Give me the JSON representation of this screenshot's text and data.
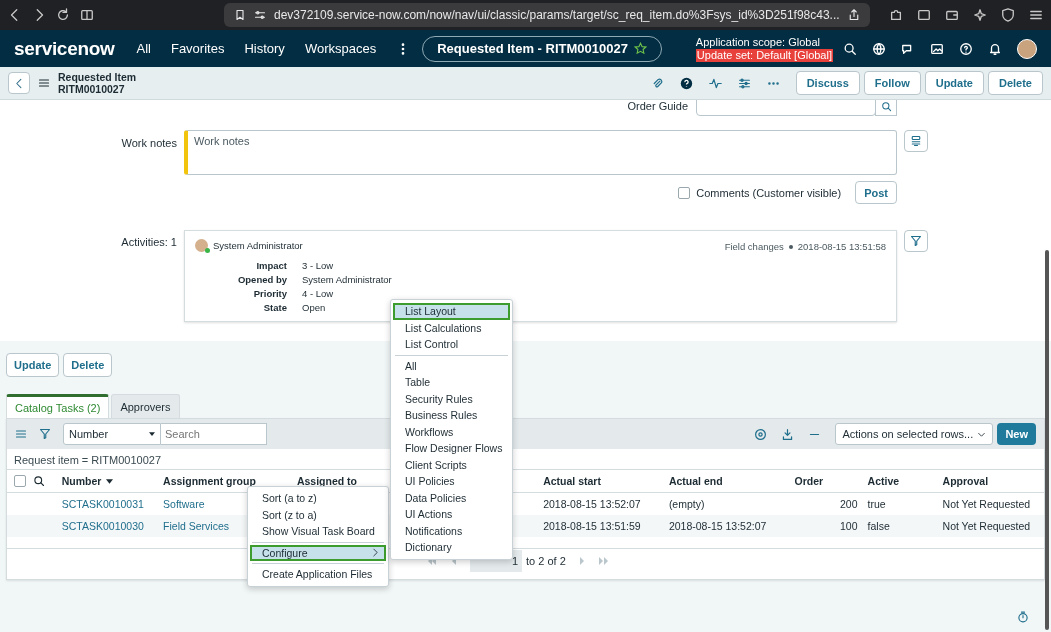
{
  "browser": {
    "url": "dev372109.service-now.com/now/nav/ui/classic/params/target/sc_req_item.do%3Fsys_id%3D251f98c43..."
  },
  "nav": {
    "logo": "servicenow",
    "items": [
      "All",
      "Favorites",
      "History",
      "Workspaces"
    ],
    "title": "Requested Item - RITM0010027",
    "scope": "Application scope: Global",
    "update_set": "Update set: Default [Global]"
  },
  "header": {
    "title": "Requested Item",
    "number": "RITM0010027",
    "buttons": [
      "Discuss",
      "Follow",
      "Update",
      "Delete"
    ]
  },
  "form": {
    "order_guide": "Order Guide",
    "work_notes_label": "Work notes",
    "work_notes_placeholder": "Work notes",
    "comments": {
      "label": "Comments (Customer visible)",
      "checked": false
    },
    "post": "Post",
    "activities_label": "Activities: 1",
    "activity": {
      "user": "System Administrator",
      "meta": "Field changes",
      "time": "2018-08-15 13:51:58",
      "fields": [
        {
          "label": "Impact",
          "value": "3 - Low"
        },
        {
          "label": "Opened by",
          "value": "System Administrator"
        },
        {
          "label": "Priority",
          "value": "4 - Low"
        },
        {
          "label": "State",
          "value": "Open"
        }
      ]
    }
  },
  "bottom_buttons": [
    "Update",
    "Delete"
  ],
  "tabs": [
    {
      "label": "Catalog Tasks (2)",
      "selected": true
    },
    {
      "label": "Approvers",
      "selected": false
    }
  ],
  "list": {
    "select_all_checked": false,
    "filter_field": "Number",
    "search_placeholder": "Search",
    "actions": "Actions on selected rows...",
    "new": "New",
    "breadcrumb": "Request item = RITM0010027",
    "columns": [
      "Number",
      "Assignment group",
      "Assigned to",
      "Actual start",
      "Actual end",
      "Order",
      "Active",
      "Approval"
    ],
    "rows": [
      {
        "number": "SCTASK0010031",
        "group": "Software",
        "start": "2018-08-15 13:52:07",
        "end": "(empty)",
        "order": "200",
        "active": "true",
        "approval": "Not Yet Requested"
      },
      {
        "number": "SCTASK0010030",
        "group": "Field Services",
        "start": "2018-08-15 13:51:59",
        "end": "2018-08-15 13:52:07",
        "order": "100",
        "active": "false",
        "approval": "Not Yet Requested"
      }
    ],
    "page_current": "1",
    "page_range": "to 2 of 2"
  },
  "context_menu": [
    {
      "kind": "item",
      "label": "Sort (a to z)",
      "selected": false
    },
    {
      "kind": "item",
      "label": "Sort (z to a)",
      "selected": false
    },
    {
      "kind": "item",
      "label": "Show Visual Task Board",
      "selected": false
    },
    {
      "kind": "separator"
    },
    {
      "kind": "submenu",
      "label": "Configure",
      "selected": true
    },
    {
      "kind": "separator"
    },
    {
      "kind": "item",
      "label": "Create Application Files",
      "selected": false
    }
  ],
  "submenu": [
    {
      "kind": "item",
      "label": "List Layout",
      "selected": true
    },
    {
      "kind": "item",
      "label": "List Calculations",
      "selected": false
    },
    {
      "kind": "item",
      "label": "List Control",
      "selected": false
    },
    {
      "kind": "separator"
    },
    {
      "kind": "item",
      "label": "All",
      "selected": false
    },
    {
      "kind": "item",
      "label": "Table",
      "selected": false
    },
    {
      "kind": "item",
      "label": "Security Rules",
      "selected": false
    },
    {
      "kind": "item",
      "label": "Business Rules",
      "selected": false
    },
    {
      "kind": "item",
      "label": "Workflows",
      "selected": false
    },
    {
      "kind": "item",
      "label": "Flow Designer Flows",
      "selected": false
    },
    {
      "kind": "item",
      "label": "Client Scripts",
      "selected": false
    },
    {
      "kind": "item",
      "label": "UI Policies",
      "selected": false
    },
    {
      "kind": "item",
      "label": "Data Policies",
      "selected": false
    },
    {
      "kind": "item",
      "label": "UI Actions",
      "selected": false
    },
    {
      "kind": "item",
      "label": "Notifications",
      "selected": false
    },
    {
      "kind": "item",
      "label": "Dictionary",
      "selected": false
    }
  ]
}
